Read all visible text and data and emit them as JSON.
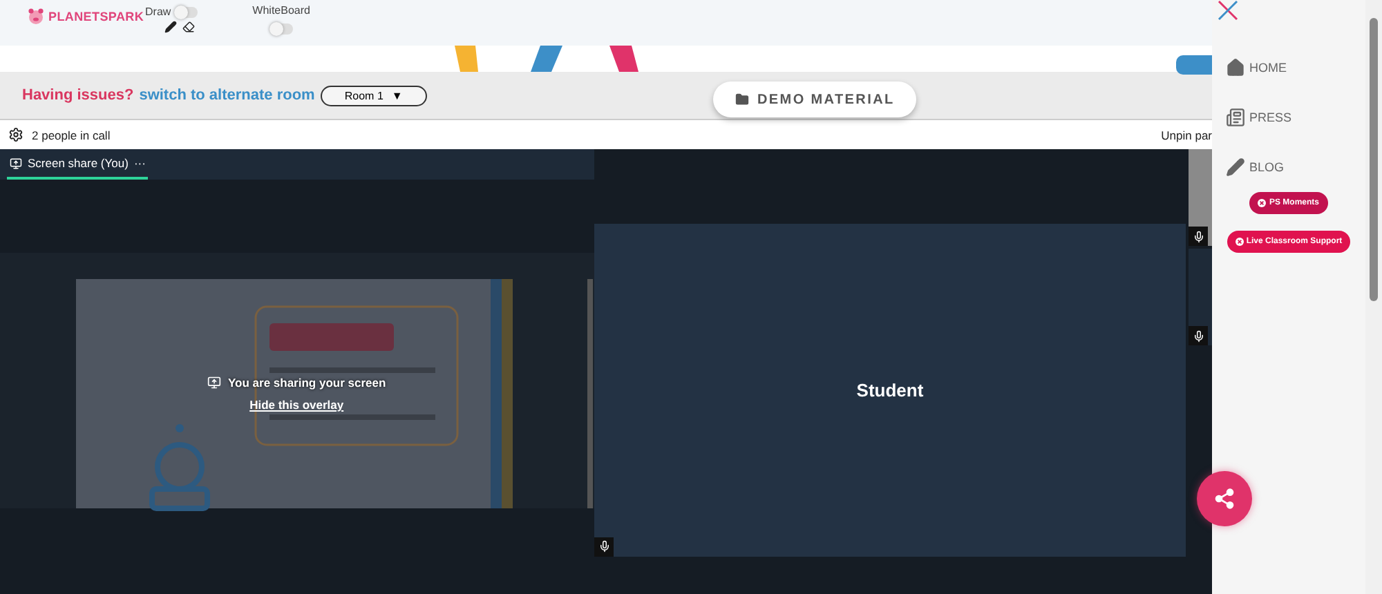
{
  "header": {
    "logo": "PLANETSPARK",
    "draw": {
      "label": "Draw",
      "on": false
    },
    "whiteboard": {
      "label": "WhiteBoard",
      "on": false
    }
  },
  "room_bar": {
    "issue": "Having issues?",
    "link": "switch to alternate room",
    "room": "Room 1",
    "caret": "▼",
    "demo_button": "DEMO MATERIAL"
  },
  "call_bar": {
    "people": "2 people in call",
    "unpin": "Unpin par"
  },
  "screen_share": {
    "tab": {
      "label": "Screen share (You)",
      "more": "···",
      "selected": true
    },
    "overlay_text": "You are sharing your screen",
    "overlay_link": "Hide this overlay"
  },
  "student_tile": {
    "name": "Student"
  },
  "sidebar": {
    "items": [
      {
        "label": "HOME",
        "kind": "home"
      },
      {
        "label": "PRESS",
        "kind": "press"
      },
      {
        "label": "BLOG",
        "kind": "blog"
      }
    ],
    "pills": [
      {
        "label": "PS Moments",
        "color": "#c2124f"
      },
      {
        "label": "Live Classroom Support",
        "color": "#e0124f"
      }
    ]
  }
}
